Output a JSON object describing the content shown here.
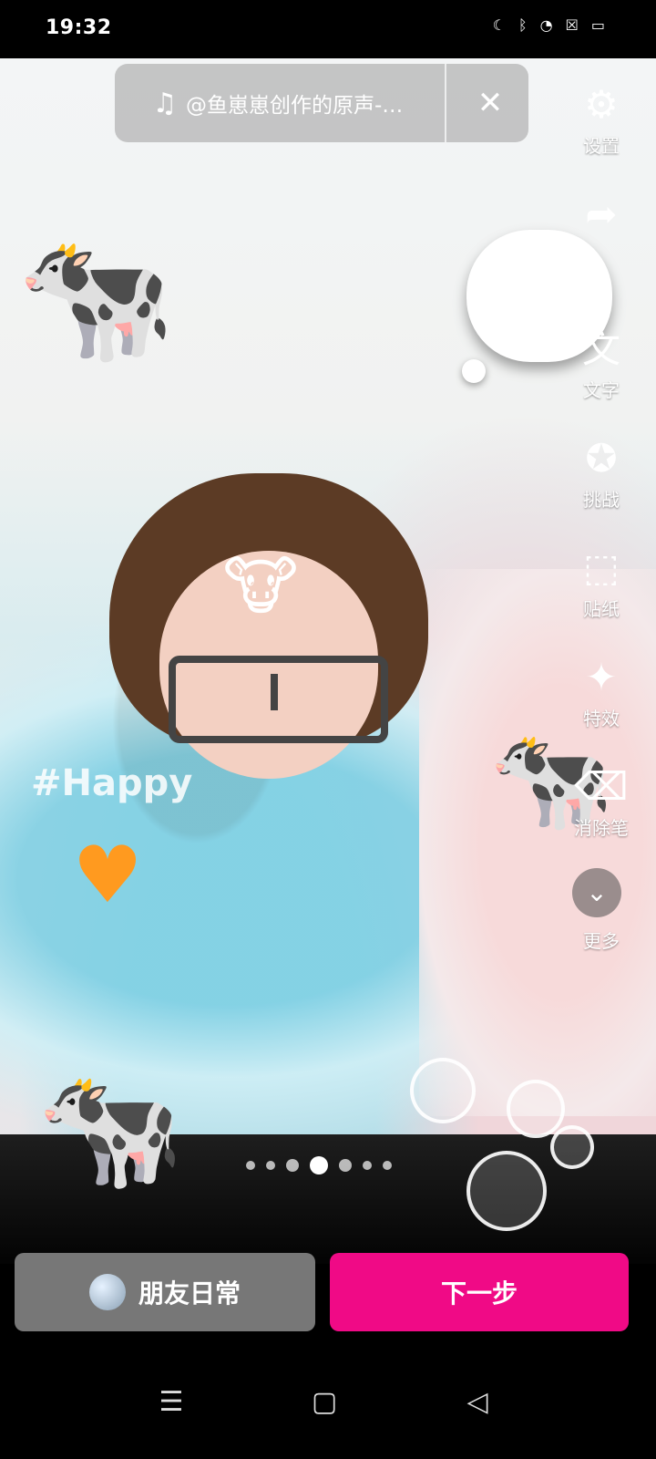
{
  "status_bar": {
    "time": "19:32",
    "icons": [
      "moon-icon",
      "bluetooth-icon",
      "wifi-icon",
      "close-box-icon",
      "battery-icon"
    ]
  },
  "music_bar": {
    "icon": "music-note-icon",
    "text": "@鱼崽崽创作的原声-…",
    "close_icon": "close-icon"
  },
  "tools": [
    {
      "name": "settings",
      "label": "设置",
      "icon": "gear-icon"
    },
    {
      "name": "share",
      "label": "",
      "icon": "share-icon"
    },
    {
      "name": "text",
      "label": "文字",
      "icon": "text-icon"
    },
    {
      "name": "challenge",
      "label": "挑战",
      "icon": "star-icon"
    },
    {
      "name": "sticker",
      "label": "贴纸",
      "icon": "sticker-icon"
    },
    {
      "name": "effects",
      "label": "特效",
      "icon": "sparkle-icon"
    },
    {
      "name": "eraser",
      "label": "消除笔",
      "icon": "eraser-icon"
    },
    {
      "name": "more",
      "label": "更多",
      "icon": "chevron-down-icon"
    }
  ],
  "hashtag_text": "#Happy",
  "page_dots": {
    "count": 7,
    "active_index": 3
  },
  "bottom": {
    "left_button": "朋友日常",
    "right_button": "下一步"
  },
  "nav": [
    "menu-icon",
    "home-square-icon",
    "back-triangle-icon"
  ],
  "colors": {
    "primary": "#f00a86",
    "secondary_button": "#777777",
    "background": "#000000"
  }
}
